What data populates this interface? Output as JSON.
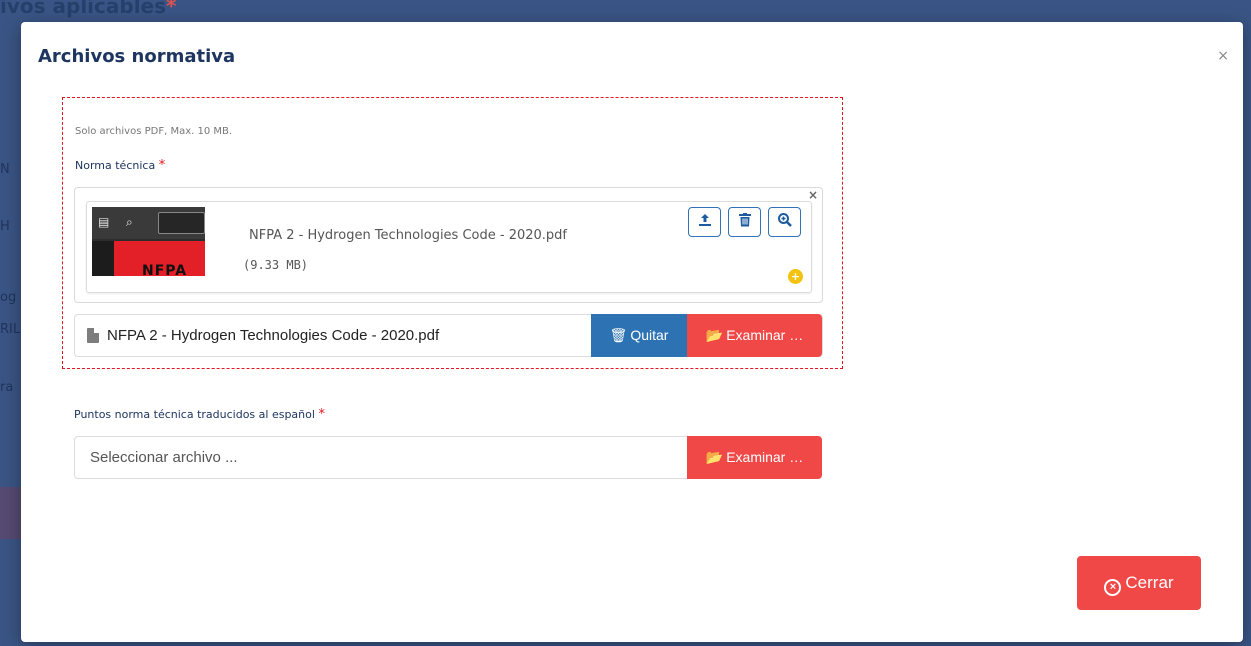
{
  "background": {
    "title": "ivos aplicables",
    "fragments": [
      "N",
      "H",
      "og",
      "RIL",
      "ra"
    ]
  },
  "modal": {
    "title": "Archivos normativa",
    "close_glyph": "×",
    "hint": "Solo archivos PDF, Max. 10 MB.",
    "norma_tecnica": {
      "label": "Norma técnica",
      "required_mark": "*",
      "preview": {
        "file_name": "NFPA 2 - Hydrogen Technologies Code - 2020.pdf",
        "file_size": "(9.33 MB)",
        "thumb_text": "NFPA",
        "close_glyph": "×",
        "plus_glyph": "+"
      },
      "input_value": "NFPA 2 - Hydrogen Technologies Code - 2020.pdf",
      "remove_label": "Quitar",
      "browse_label": "Examinar …"
    },
    "puntos": {
      "label": "Puntos norma técnica traducidos al español",
      "required_mark": "*",
      "placeholder": "Seleccionar archivo ...",
      "browse_label": "Examinar …"
    },
    "close_button_label": "Cerrar"
  },
  "icons": {
    "upload": "upload-icon",
    "delete": "trash-icon",
    "zoom": "zoom-in-icon",
    "folder": "folder-open-icon",
    "file": "file-icon",
    "close_circle": "close-circle-icon"
  },
  "colors": {
    "primary": "#2d73b4",
    "danger": "#f04747",
    "heading": "#1e3560",
    "dashed_border": "#e0151f",
    "plus_badge": "#f4c30f"
  }
}
